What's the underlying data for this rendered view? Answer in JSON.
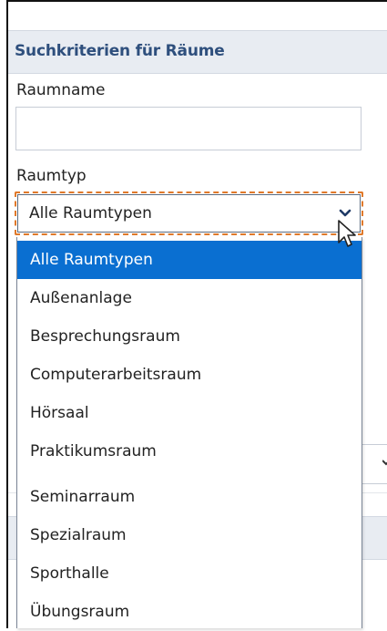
{
  "panel": {
    "title": "Suchkriterien für Räume"
  },
  "fields": {
    "raumname_label": "Raumname",
    "raumname_value": "",
    "raumtyp_label": "Raumtyp",
    "raumtyp_selected": "Alle Raumtypen"
  },
  "dropdown": {
    "options": [
      "Alle Raumtypen",
      "Außenanlage",
      "Besprechungsraum",
      "Computerarbeitsraum",
      "Hörsaal",
      "Praktikumsraum",
      "Seminarraum",
      "Spezialraum",
      "Sporthalle",
      "Übungsraum"
    ],
    "selected_index": 0
  },
  "icons": {
    "select_arrow": "chevron-down-icon",
    "pointer": "mouse-cursor-icon"
  },
  "colors": {
    "accent": "#0a6fd1",
    "focus_outline": "#e0792a",
    "header_bg": "#e8ecf2",
    "header_text": "#2e4f7d"
  }
}
